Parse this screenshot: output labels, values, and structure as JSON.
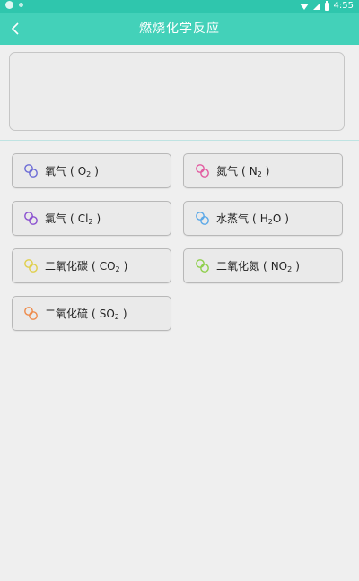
{
  "status": {
    "time": "4:55"
  },
  "header": {
    "title": "燃烧化学反应"
  },
  "colors": {
    "oxygen": "#6b6bd6",
    "nitrogen": "#e25aa0",
    "chlorine": "#8a4fd0",
    "water_vapor": "#5aa8e8",
    "carbon_dioxide": "#e0cf4a",
    "nitrogen_dioxide": "#8ecf4a",
    "sulfur_dioxide": "#ee8a4a"
  },
  "gases": [
    {
      "name": "氧气",
      "formula": "O",
      "sub": "2",
      "icon": "molecule-icon"
    },
    {
      "name": "氮气",
      "formula": "N",
      "sub": "2",
      "icon": "molecule-icon"
    },
    {
      "name": "氯气",
      "formula": "Cl",
      "sub": "2",
      "icon": "molecule-icon"
    },
    {
      "name": "水蒸气",
      "formula": "H",
      "sub": "2",
      "formula2": "O",
      "icon": "molecule-icon"
    },
    {
      "name": "二氧化碳",
      "formula": "CO",
      "sub": "2",
      "icon": "molecule-icon"
    },
    {
      "name": "二氧化氮",
      "formula": "NO",
      "sub": "2",
      "icon": "molecule-icon"
    },
    {
      "name": "二氧化硫",
      "formula": "SO",
      "sub": "2",
      "icon": "molecule-icon"
    }
  ]
}
